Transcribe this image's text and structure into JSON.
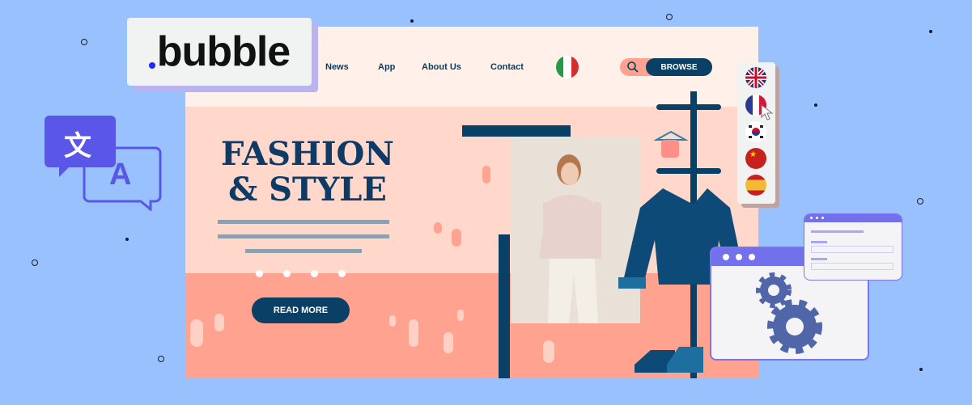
{
  "logo": {
    "text": "bubble"
  },
  "nav": {
    "items": [
      "News",
      "App",
      "About Us",
      "Contact"
    ],
    "browse_label": "BROWSE",
    "current_language_flag": "italy-flag"
  },
  "hero": {
    "title_line1": "FASHION",
    "title_line2": "& STYLE",
    "read_more_label": "READ MORE"
  },
  "language_menu": {
    "flags": [
      "united-kingdom-flag",
      "france-flag",
      "south-korea-flag",
      "china-flag",
      "spain-flag"
    ],
    "hovered": "france-flag"
  },
  "translate_icon": {
    "source_glyph": "文",
    "target_glyph": "A"
  },
  "colors": {
    "background": "#98c1fd",
    "navy": "#0a4066",
    "salmon": "#ffa390",
    "peach": "#ffd7cb",
    "purple": "#7270ea",
    "gear": "#5166a8"
  }
}
